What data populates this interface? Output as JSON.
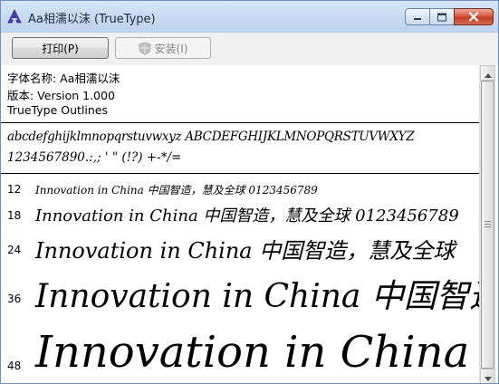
{
  "window": {
    "title": "Aa相濡以沫 (TrueType)"
  },
  "toolbar": {
    "print_label": "打印(P)",
    "install_label": "安装(I)"
  },
  "font_info": {
    "name_line": "字体名称: Aa相濡以沫",
    "version_line": "版本: Version 1.000",
    "outline_line": "TrueType Outlines"
  },
  "charset": {
    "line1": "abcdefghijklmnopqrstuvwxyz ABCDEFGHIJKLMNOPQRSTUVWXYZ",
    "line2": "1234567890.:,; ' \" (!?) +-*/="
  },
  "samples": [
    {
      "size": "12",
      "text": "Innovation in China 中国智造，慧及全球 0123456789"
    },
    {
      "size": "18",
      "text": "Innovation in China 中国智造，慧及全球 0123456789"
    },
    {
      "size": "24",
      "text": "Innovation in China 中国智造，慧及全球"
    },
    {
      "size": "36",
      "text": "Innovation in China 中国智造"
    },
    {
      "size": "48",
      "text": "Innovation in China"
    }
  ]
}
